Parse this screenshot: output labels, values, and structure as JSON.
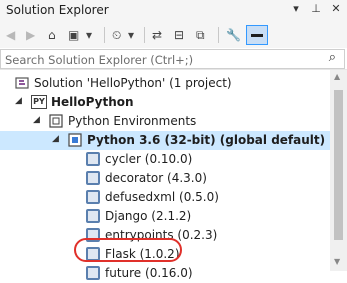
{
  "window": {
    "title": "Solution Explorer",
    "buttons": [
      "▾",
      "⊥",
      "✕"
    ]
  },
  "search": {
    "placeholder": "Search Solution Explorer (Ctrl+;)"
  },
  "tree": {
    "solution": "Solution 'HelloPython' (1 project)",
    "project": "HelloPython",
    "environments": "Python Environments",
    "interpreter": "Python 3.6 (32-bit) (global default)",
    "packages": [
      "cycler (0.10.0)",
      "decorator (4.3.0)",
      "defusedxml (0.5.0)",
      "Django (2.1.2)",
      "entrypoints (0.2.3)",
      "Flask (1.0.2)",
      "future (0.16.0)"
    ]
  },
  "icons": {
    "project_badge": "PY"
  },
  "colors": {
    "selection": "#cce8ff",
    "highlight_circle": "#e0302a",
    "accent": "#3399ff"
  }
}
